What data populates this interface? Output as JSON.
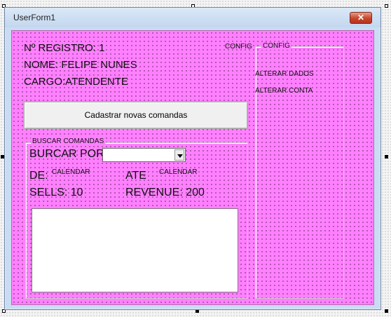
{
  "window": {
    "title": "UserForm1",
    "close_label": "✕"
  },
  "info": {
    "registro": "Nº REGISTRO: 1",
    "nome": "NOME: FELIPE NUNES",
    "cargo": "CARGO:ATENDENTE"
  },
  "actions": {
    "cadastrar_label": "Cadastrar novas comandas"
  },
  "config": {
    "outer_label": "CONFIG",
    "frame_caption": "CONFIG",
    "alterar_dados": "ALTERAR DADOS",
    "alterar_conta": "ALTERAR CONTA"
  },
  "search": {
    "frame_caption": "BUSCAR COMANDAS",
    "burcar_por_label": "BURCAR POR:",
    "combo_value": "",
    "de_label": "DE:",
    "de_calendar": "CALENDAR",
    "ate_label": "ATE",
    "ate_calendar": "CALENDAR",
    "sells": "SELLS: 10",
    "revenue": "REVENUE: 200"
  },
  "colors": {
    "form_background": "#ff80ff",
    "button_face": "#f0f0f0",
    "close_button": "#c6442b"
  }
}
